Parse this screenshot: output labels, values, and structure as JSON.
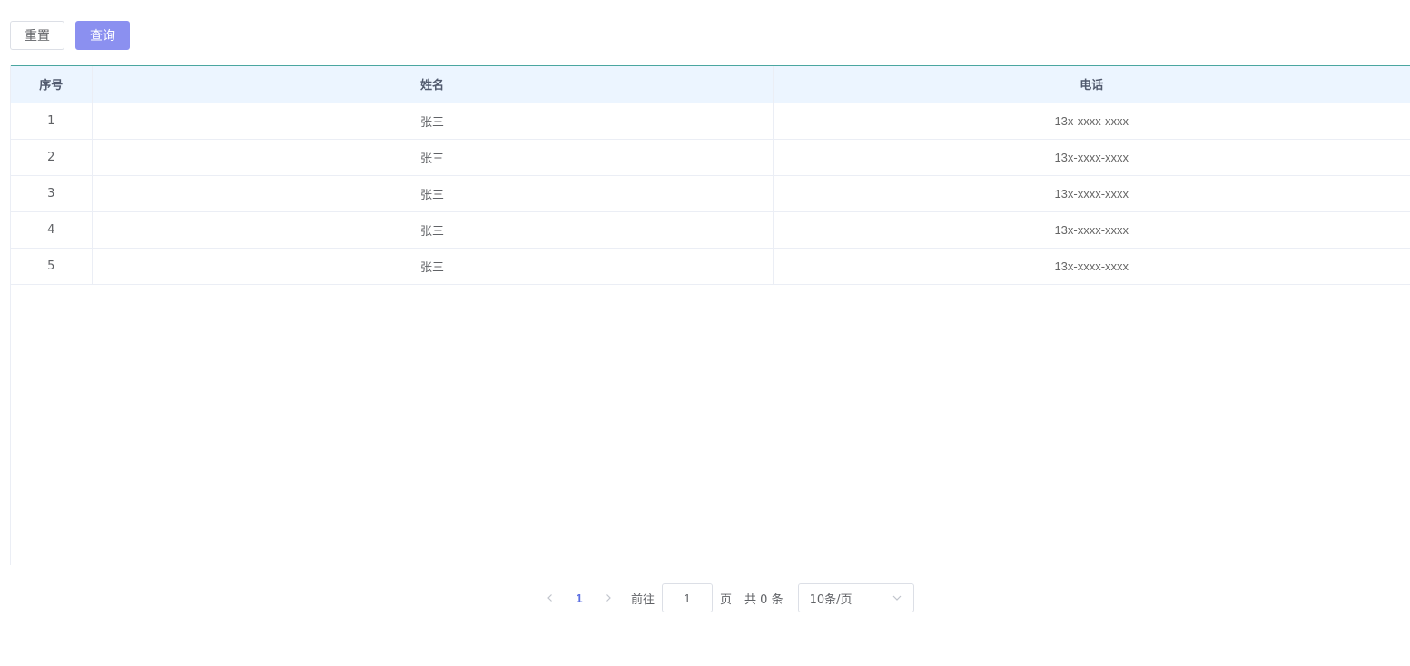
{
  "toolbar": {
    "reset_label": "重置",
    "query_label": "查询"
  },
  "table": {
    "columns": [
      "序号",
      "姓名",
      "电话"
    ],
    "rows": [
      [
        "1",
        "张三",
        "13x-xxxx-xxxx"
      ],
      [
        "2",
        "张三",
        "13x-xxxx-xxxx"
      ],
      [
        "3",
        "张三",
        "13x-xxxx-xxxx"
      ],
      [
        "4",
        "张三",
        "13x-xxxx-xxxx"
      ],
      [
        "5",
        "张三",
        "13x-xxxx-xxxx"
      ]
    ]
  },
  "pagination": {
    "current_page": "1",
    "goto_prefix": "前往",
    "goto_value": "1",
    "goto_suffix": "页",
    "total_text": "共 0 条",
    "page_size": "10条/页"
  },
  "colors": {
    "primary": "#8b90f0",
    "header_bg": "#ecf5ff",
    "table_top_line": "#4aa6a0",
    "active_page": "#5b6ee1"
  },
  "icons": {
    "prev": "chevron-left-icon",
    "next": "chevron-right-icon",
    "dropdown": "chevron-down-icon"
  }
}
